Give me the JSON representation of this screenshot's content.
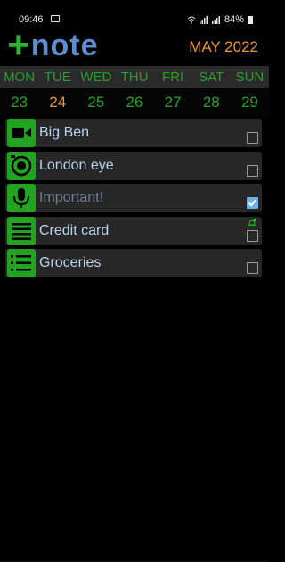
{
  "status_bar": {
    "time": "09:46",
    "battery": "84%"
  },
  "header": {
    "logo_plus": "+",
    "logo_text": "note",
    "month_year": "MAY 2022"
  },
  "calendar": {
    "weekdays": [
      "MON",
      "TUE",
      "WED",
      "THU",
      "FRI",
      "SAT",
      "SUN"
    ],
    "days": [
      "23",
      "24",
      "25",
      "26",
      "27",
      "28",
      "29"
    ],
    "today": "24"
  },
  "notes": [
    {
      "title": "Big Ben",
      "icon": "video-camera-icon",
      "checked": false,
      "alarm": false
    },
    {
      "title": "London eye",
      "icon": "photo-camera-icon",
      "checked": false,
      "alarm": false
    },
    {
      "title": "Important!",
      "icon": "microphone-icon",
      "checked": true,
      "alarm": false
    },
    {
      "title": "Credit card",
      "icon": "text-note-icon",
      "checked": false,
      "alarm": true
    },
    {
      "title": "Groceries",
      "icon": "checklist-icon",
      "checked": false,
      "alarm": false
    }
  ],
  "colors": {
    "accent_green": "#22a322",
    "today_orange": "#e8963a",
    "title_blue": "#b8d4f0",
    "check_blue": "#6fb1e6"
  }
}
